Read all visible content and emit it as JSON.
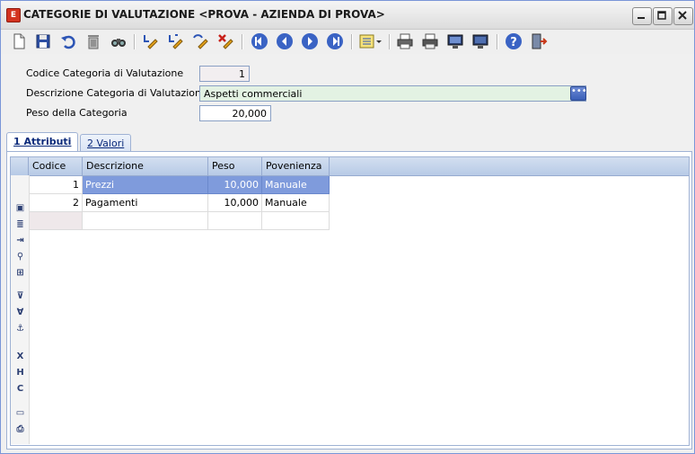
{
  "window": {
    "title": "CATEGORIE DI VALUTAZIONE <PROVA - AZIENDA DI PROVA>",
    "app_icon_letter": "E"
  },
  "toolbar": {
    "icons": [
      "new-document-icon",
      "save-icon",
      "undo-icon",
      "delete-icon",
      "find-icon",
      "edit-pencil-icon",
      "edit-confirm-icon",
      "edit-undo-icon",
      "edit-cancel-icon",
      "first-record-icon",
      "previous-record-icon",
      "next-record-icon",
      "last-record-icon",
      "list-options-icon",
      "print-icon",
      "print-preview-icon",
      "screen-output-icon",
      "screen-output-alt-icon",
      "help-icon",
      "exit-icon"
    ]
  },
  "form": {
    "codice_label": "Codice Categoria di Valutazione",
    "codice_value": "1",
    "descrizione_label": "Descrizione Categoria di Valutazione",
    "descrizione_value": "Aspetti commerciali",
    "peso_label": "Peso della Categoria",
    "peso_value": "20,000"
  },
  "tabs": [
    {
      "label": "1 Attributi",
      "active": true
    },
    {
      "label": "2 Valori",
      "active": false
    }
  ],
  "grid": {
    "columns": [
      "Codice",
      "Descrizione",
      "Peso",
      "Povenienza"
    ],
    "rows": [
      {
        "codice": "1",
        "descrizione": "Prezzi",
        "peso": "10,000",
        "provenienza": "Manuale"
      },
      {
        "codice": "2",
        "descrizione": "Pagamenti",
        "peso": "10,000",
        "provenienza": "Manuale"
      }
    ],
    "side_tools": [
      "copy-row-icon",
      "list-icon",
      "insert-row-icon",
      "zoom-icon",
      "grid-icon",
      "filter-icon",
      "clear-filter-icon",
      "anchor-icon",
      "remove-column-icon",
      "hide-column-icon",
      "column-settings-icon",
      "screen-icon",
      "print-icon"
    ]
  },
  "colors": {
    "selection": "#7f9bdc",
    "field_highlight": "#e3f2e3",
    "header_bg": "#c5d5ec",
    "nav_blue": "#3a63c4"
  }
}
